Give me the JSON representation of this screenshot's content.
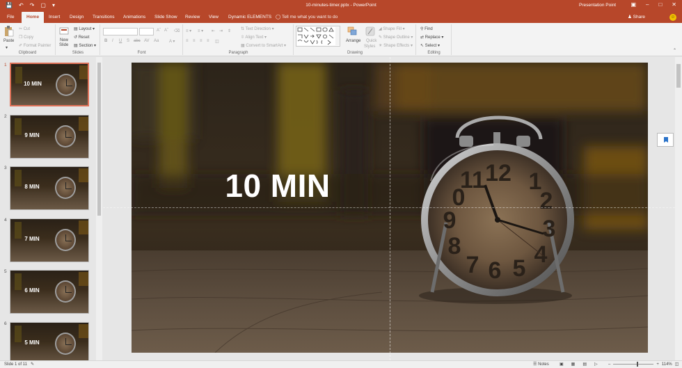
{
  "titlebar": {
    "document_title": "10-minutes-timer.pptx - PowerPoint",
    "account": "Presentation Point"
  },
  "tabs": [
    {
      "label": "File"
    },
    {
      "label": "Home"
    },
    {
      "label": "Insert"
    },
    {
      "label": "Design"
    },
    {
      "label": "Transitions"
    },
    {
      "label": "Animations"
    },
    {
      "label": "Slide Show"
    },
    {
      "label": "Review"
    },
    {
      "label": "View"
    },
    {
      "label": "Dynamic ELEMENTS"
    }
  ],
  "active_tab": "Home",
  "tell_me": "Tell me what you want to do",
  "share_label": "Share",
  "ribbon": {
    "clipboard": {
      "paste": "Paste",
      "cut": "Cut",
      "copy": "Copy",
      "format_painter": "Format Painter",
      "label": "Clipboard"
    },
    "slides": {
      "new_slide": "New",
      "new_slide2": "Slide",
      "layout": "Layout",
      "reset": "Reset",
      "section": "Section",
      "label": "Slides"
    },
    "font": {
      "label": "Font"
    },
    "paragraph": {
      "text_direction": "Text Direction",
      "align_text": "Align Text",
      "convert": "Convert to SmartArt",
      "label": "Paragraph"
    },
    "drawing": {
      "arrange": "Arrange",
      "quick_styles": "Quick",
      "quick_styles2": "Styles",
      "shape_fill": "Shape Fill",
      "shape_outline": "Shape Outline",
      "shape_effects": "Shape Effects",
      "label": "Drawing"
    },
    "editing": {
      "find": "Find",
      "replace": "Replace",
      "select": "Select",
      "label": "Editing"
    }
  },
  "slides": [
    {
      "number": "1",
      "text": "10 MIN"
    },
    {
      "number": "2",
      "text": "9 MIN"
    },
    {
      "number": "3",
      "text": "8 MIN"
    },
    {
      "number": "4",
      "text": "7 MIN"
    },
    {
      "number": "5",
      "text": "6 MIN"
    },
    {
      "number": "6",
      "text": "5 MIN"
    }
  ],
  "current_slide": {
    "title": "10 MIN"
  },
  "statusbar": {
    "slide_info": "Slide 1 of 11",
    "notes": "Notes",
    "zoom": "114%"
  },
  "colors": {
    "accent": "#b7472a"
  }
}
